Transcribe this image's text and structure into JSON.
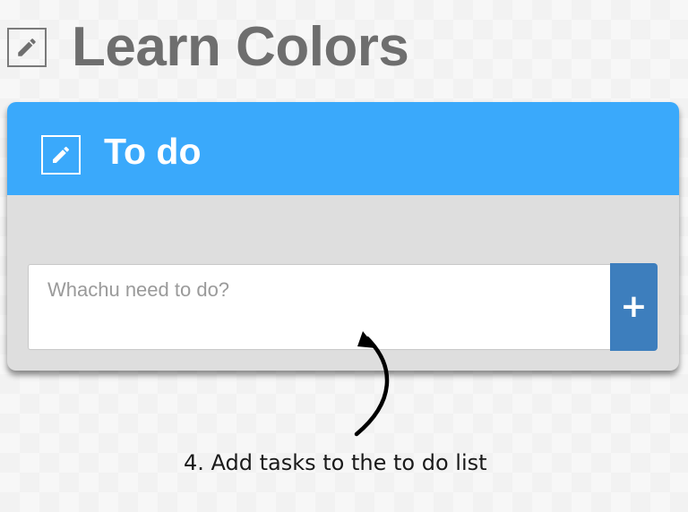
{
  "page": {
    "title": "Learn Colors",
    "edit_icon": "pencil-icon"
  },
  "list": {
    "title": "To do",
    "edit_icon": "pencil-icon",
    "header_color": "#3aa9fb",
    "body_color": "#dedede",
    "input": {
      "value": "",
      "placeholder": "Whachu need to do?"
    },
    "add_button": {
      "label": "+",
      "icon": "plus-icon",
      "color": "#3d7ebd"
    }
  },
  "annotation": {
    "text": "4. Add tasks to the to do list",
    "arrow_icon": "curved-arrow-icon"
  }
}
